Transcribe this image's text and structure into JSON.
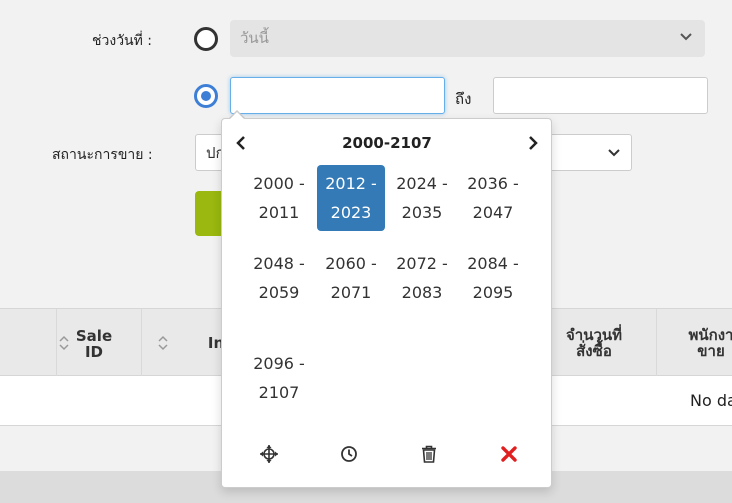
{
  "form": {
    "date_range_label": "ช่วงวันที่ :",
    "preset_select_value": "วันนี้",
    "from_value": "",
    "to_label": "ถึง",
    "to_value": "",
    "status_label": "สถานะการขาย :",
    "status_select_value": "ปก"
  },
  "table": {
    "headers": [
      {
        "label_line1": "Sale",
        "label_line2": "ID"
      },
      {
        "label_line1": "In",
        "label_line2": ""
      },
      {
        "label_line1": "จำนวนที่",
        "label_line2": "สั่งซื้อ"
      },
      {
        "label_line1": "พนักงา",
        "label_line2": "ขาย"
      }
    ],
    "empty_text": "No da"
  },
  "picker": {
    "title": "2000-2107",
    "decades": [
      {
        "start": "2000 -",
        "end": "2011",
        "active": false
      },
      {
        "start": "2012 -",
        "end": "2023",
        "active": true
      },
      {
        "start": "2024 -",
        "end": "2035",
        "active": false
      },
      {
        "start": "2036 -",
        "end": "2047",
        "active": false
      },
      {
        "start": "2048 -",
        "end": "2059",
        "active": false
      },
      {
        "start": "2060 -",
        "end": "2071",
        "active": false
      },
      {
        "start": "2072 -",
        "end": "2083",
        "active": false
      },
      {
        "start": "2084 -",
        "end": "2095",
        "active": false
      },
      {
        "start": "2096 -",
        "end": "2107",
        "active": false
      }
    ],
    "tools": [
      "crosshair-icon",
      "clock-icon",
      "trash-icon",
      "close-icon"
    ]
  },
  "colors": {
    "accent": "#337ab7",
    "radio_selected": "#3d7fd6",
    "search_button": "#9ab80f",
    "clear_icon": "#e02020"
  }
}
